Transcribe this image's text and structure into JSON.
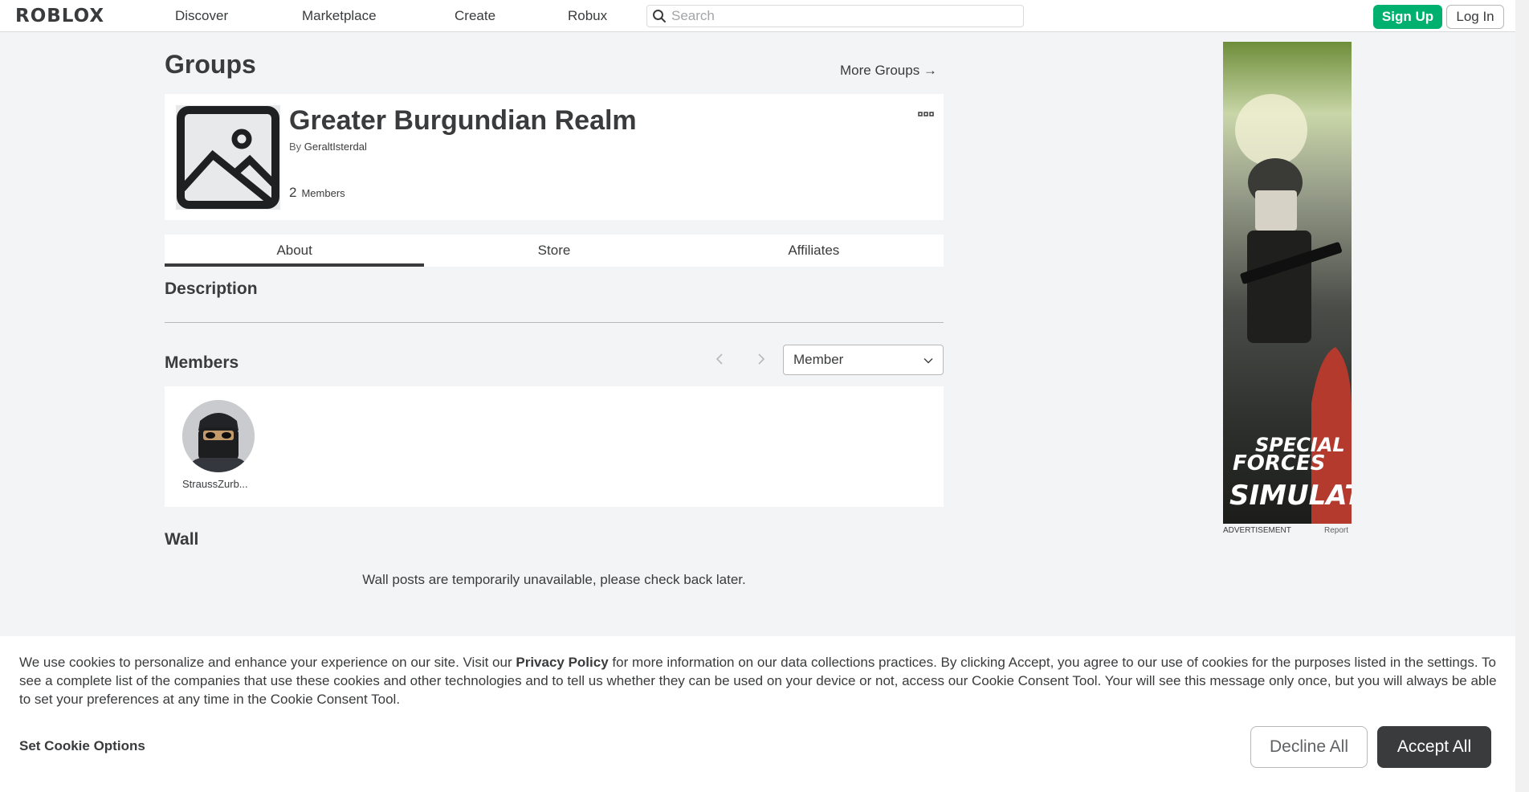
{
  "nav": {
    "logo": "ROBLOX",
    "links": [
      "Discover",
      "Marketplace",
      "Create",
      "Robux"
    ],
    "search_placeholder": "Search",
    "signup_label": "Sign Up",
    "login_label": "Log In"
  },
  "page": {
    "title": "Groups",
    "more_groups": "More Groups →"
  },
  "group": {
    "name": "Greater Burgundian Realm",
    "by_prefix": "By",
    "owner": "GeraltIsterdal",
    "member_count": "2",
    "member_label": "Members"
  },
  "tabs": [
    {
      "label": "About",
      "active": true
    },
    {
      "label": "Store",
      "active": false
    },
    {
      "label": "Affiliates",
      "active": false
    }
  ],
  "sections": {
    "description": "Description",
    "members": "Members",
    "wall": "Wall"
  },
  "members": {
    "role_selected": "Member",
    "list": [
      {
        "name": "StraussZurb..."
      }
    ]
  },
  "wall": {
    "message": "Wall posts are temporarily unavailable, please check back later."
  },
  "ad": {
    "line1": "SPECIAL",
    "line2": "FORCES",
    "line3": "SIMULATOR",
    "label": "ADVERTISEMENT",
    "report": "Report"
  },
  "cookie": {
    "text_1": "We use cookies to personalize and enhance your experience on our site. Visit our ",
    "policy_link": "Privacy Policy",
    "text_2": " for more information on our data collections practices. By clicking Accept, you agree to our use of cookies for the purposes listed in the settings. To see a complete list of the companies that use these cookies and other technologies and to tell us whether they can be used on your device or not, access our Cookie Consent Tool. Your will see this message only once, but you will always be able to set your preferences at any time in the Cookie Consent Tool.",
    "options_label": "Set Cookie Options",
    "decline_label": "Decline All",
    "accept_label": "Accept All"
  },
  "colors": {
    "accent_green": "#00b06f",
    "text_dark": "#393b3d",
    "background": "#f2f4f5"
  }
}
